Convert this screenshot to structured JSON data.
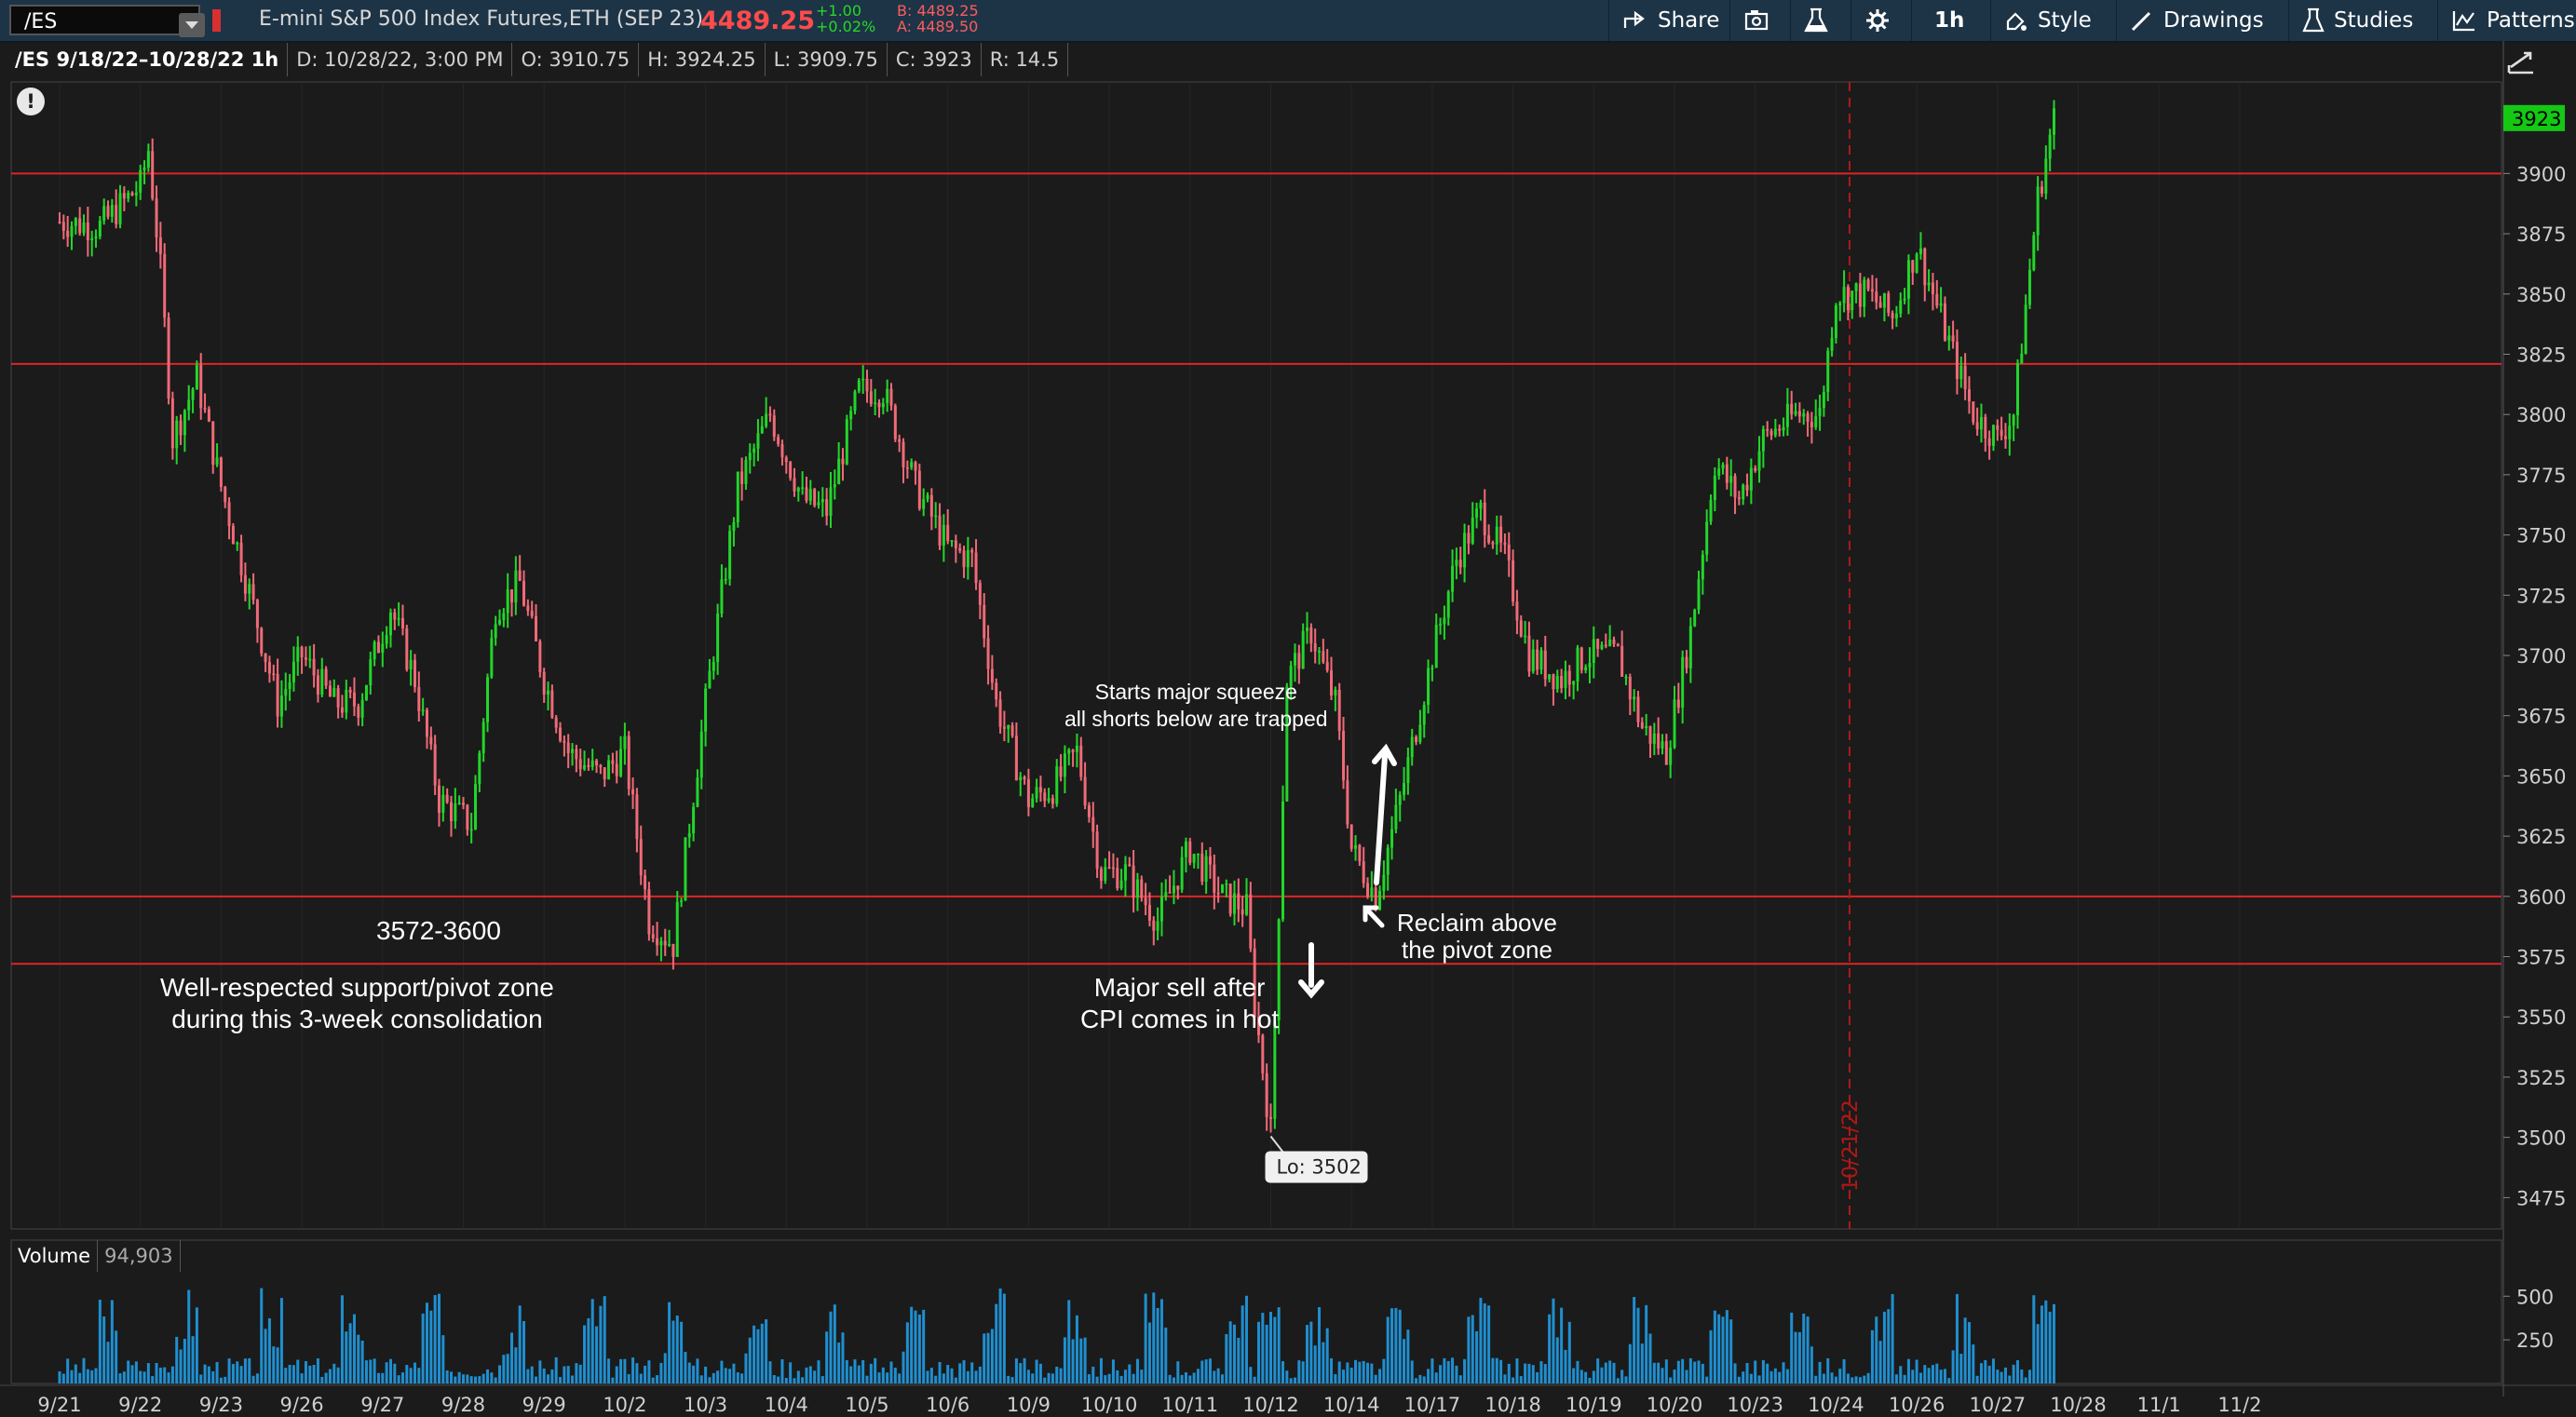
{
  "toolbar": {
    "symbol": "/ES",
    "instrument": "E-mini S&P 500 Index Futures,ETH (SEP 23)",
    "last": "4489.25",
    "change": "+1.00",
    "change_pct": "+0.02%",
    "bid": "B: 4489.25",
    "ask": "A: 4489.50",
    "share": "Share",
    "interval": "1h",
    "style": "Style",
    "drawings": "Drawings",
    "studies": "Studies",
    "patterns": "Patterns"
  },
  "info": {
    "range": "/ES 9/18/22–10/28/22 1h",
    "date": "D: 10/28/22, 3:00 PM",
    "open": "O: 3910.75",
    "high": "H: 3924.25",
    "low": "L: 3909.75",
    "close": "C: 3923",
    "range_val": "R: 14.5"
  },
  "annotations": {
    "zone_title": "3572-3600",
    "zone_desc_1": "Well-respected support/pivot zone",
    "zone_desc_2": "during this 3-week consolidation",
    "cpi_1": "Major sell after",
    "cpi_2": "CPI comes in hot",
    "squeeze_1": "Starts major squeeze",
    "squeeze_2": "all shorts below are trapped",
    "reclaim_1": "Reclaim above",
    "reclaim_2": "the pivot zone",
    "low_label": "Lo: 3502",
    "vline_date": "10/21/22",
    "last_tag": "3923",
    "alert": "!"
  },
  "volume_panel": {
    "label": "Volume",
    "value": "94,903",
    "ticks": [
      "500",
      "250"
    ]
  },
  "colors": {
    "up": "#22d62a",
    "down": "#f06a78",
    "level_line": "#e02424",
    "volume": "#1f8fd0"
  },
  "chart_data": {
    "type": "candlestick",
    "timeframe": "1h",
    "y_ticks": [
      3475,
      3500,
      3525,
      3550,
      3575,
      3600,
      3625,
      3650,
      3675,
      3700,
      3725,
      3750,
      3775,
      3800,
      3825,
      3850,
      3875,
      3900
    ],
    "ylim": [
      3462,
      3938
    ],
    "x_labels": [
      "9/21",
      "9/22",
      "9/23",
      "9/26",
      "9/27",
      "9/28",
      "9/29",
      "10/2",
      "10/3",
      "10/4",
      "10/5",
      "10/6",
      "10/9",
      "10/10",
      "10/11",
      "10/12",
      "10/14",
      "10/17",
      "10/18",
      "10/19",
      "10/20",
      "10/23",
      "10/24",
      "10/26",
      "10/27",
      "10/28",
      "11/1",
      "11/2"
    ],
    "horizontal_levels": [
      3900,
      3821,
      3600,
      3572
    ],
    "vertical_marker": "10/21/22",
    "price_path": [
      [
        0,
        3880
      ],
      [
        0.5,
        3878
      ],
      [
        1,
        3895
      ],
      [
        1.1,
        3910
      ],
      [
        1.25,
        3860
      ],
      [
        1.4,
        3790
      ],
      [
        1.7,
        3815
      ],
      [
        2.0,
        3770
      ],
      [
        2.4,
        3720
      ],
      [
        2.7,
        3680
      ],
      [
        3.0,
        3700
      ],
      [
        3.4,
        3680
      ],
      [
        3.7,
        3680
      ],
      [
        4.1,
        3720
      ],
      [
        4.4,
        3690
      ],
      [
        4.7,
        3640
      ],
      [
        5.1,
        3630
      ],
      [
        5.4,
        3720
      ],
      [
        5.7,
        3730
      ],
      [
        6.0,
        3690
      ],
      [
        6.3,
        3660
      ],
      [
        6.7,
        3650
      ],
      [
        7.0,
        3660
      ],
      [
        7.3,
        3590
      ],
      [
        7.6,
        3580
      ],
      [
        8.0,
        3680
      ],
      [
        8.4,
        3770
      ],
      [
        8.8,
        3800
      ],
      [
        9.2,
        3765
      ],
      [
        9.5,
        3760
      ],
      [
        9.9,
        3810
      ],
      [
        10.2,
        3810
      ],
      [
        10.6,
        3770
      ],
      [
        11.0,
        3745
      ],
      [
        11.3,
        3740
      ],
      [
        11.6,
        3680
      ],
      [
        12.0,
        3640
      ],
      [
        12.3,
        3645
      ],
      [
        12.6,
        3660
      ],
      [
        12.9,
        3610
      ],
      [
        13.2,
        3610
      ],
      [
        13.6,
        3590
      ],
      [
        14.0,
        3620
      ],
      [
        14.4,
        3600
      ],
      [
        14.7,
        3595
      ],
      [
        14.8,
        3555
      ],
      [
        15.0,
        3502
      ],
      [
        15.2,
        3690
      ],
      [
        15.5,
        3710
      ],
      [
        15.8,
        3680
      ],
      [
        16.0,
        3620
      ],
      [
        16.3,
        3600
      ],
      [
        16.6,
        3640
      ],
      [
        17.0,
        3700
      ],
      [
        17.3,
        3740
      ],
      [
        17.6,
        3760
      ],
      [
        17.9,
        3740
      ],
      [
        18.2,
        3700
      ],
      [
        18.6,
        3690
      ],
      [
        18.9,
        3700
      ],
      [
        19.3,
        3700
      ],
      [
        19.6,
        3670
      ],
      [
        19.9,
        3660
      ],
      [
        20.2,
        3710
      ],
      [
        20.5,
        3780
      ],
      [
        20.8,
        3765
      ],
      [
        21.1,
        3790
      ],
      [
        21.5,
        3800
      ],
      [
        21.8,
        3800
      ],
      [
        22.0,
        3850
      ],
      [
        22.4,
        3850
      ],
      [
        22.7,
        3840
      ],
      [
        23.0,
        3870
      ],
      [
        23.4,
        3830
      ],
      [
        23.7,
        3800
      ],
      [
        24.0,
        3790
      ],
      [
        24.2,
        3800
      ],
      [
        24.5,
        3890
      ],
      [
        24.7,
        3923
      ]
    ],
    "lo": 3502,
    "last": 3923,
    "volume_ticks": [
      250,
      500
    ],
    "volume_value": 94903
  }
}
